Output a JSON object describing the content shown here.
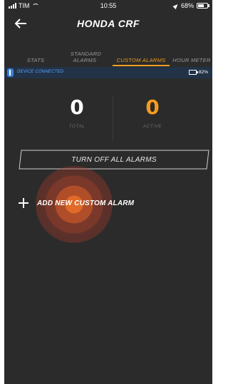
{
  "status_bar": {
    "carrier": "TIM",
    "time": "10:55",
    "battery": "68%"
  },
  "header": {
    "title": "HONDA CRF",
    "back_icon": "arrow-left-icon"
  },
  "tabs": [
    {
      "label": "STATS",
      "active": false
    },
    {
      "label": "STANDARD ALARMS",
      "active": false
    },
    {
      "label": "CUSTOM ALARMS",
      "active": true
    },
    {
      "label": "HOUR METER",
      "active": false
    }
  ],
  "device": {
    "status": "DEVICE CONNECTED",
    "battery": "82%",
    "bar_color": "#223348"
  },
  "counters": {
    "total": {
      "value": "0",
      "label": "TOTAL"
    },
    "active": {
      "value": "0",
      "label": "ACTIVE"
    }
  },
  "actions": {
    "turn_off_all": "TURN OFF ALL ALARMS",
    "add_custom": "ADD NEW CUSTOM ALARM"
  },
  "colors": {
    "accent": "#f39c1f",
    "background": "#2b2b2b",
    "device_text": "#5aa3ff"
  }
}
